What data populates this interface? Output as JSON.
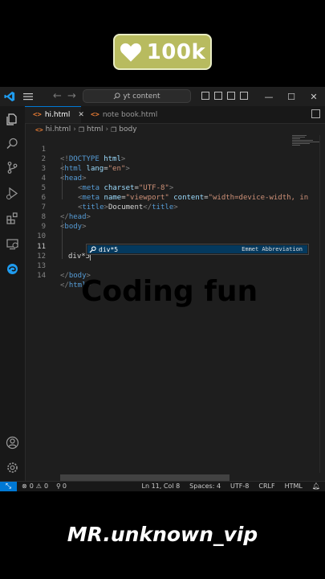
{
  "badge": {
    "count": "100k",
    "accent_color": "#b8bb5f"
  },
  "titlebar": {
    "search_text": "yt content"
  },
  "tabs": [
    {
      "label": "hi.html",
      "active": true
    },
    {
      "label": "note book.html",
      "active": false
    }
  ],
  "breadcrumb": [
    "hi.html",
    "html",
    "body"
  ],
  "editor": {
    "lines": [
      {
        "n": "1"
      },
      {
        "n": "2"
      },
      {
        "n": "3"
      },
      {
        "n": "4"
      },
      {
        "n": "5"
      },
      {
        "n": "6"
      },
      {
        "n": "7"
      },
      {
        "n": "8"
      },
      {
        "n": "9"
      },
      {
        "n": "10"
      },
      {
        "n": "11"
      },
      {
        "n": "12"
      },
      {
        "n": "13"
      },
      {
        "n": "14"
      }
    ],
    "code": {
      "l1": [
        "<!",
        "DOCTYPE",
        " html",
        ">"
      ],
      "l2": [
        "<",
        "html",
        " lang",
        "=",
        "\"en\"",
        ">"
      ],
      "l3": [
        "<",
        "head",
        ">"
      ],
      "l4": [
        "<",
        "meta",
        " charset",
        "=",
        "\"UTF-8\"",
        ">"
      ],
      "l5": [
        "<",
        "meta",
        " name",
        "=",
        "\"viewport\"",
        " content",
        "=",
        "\"width=device-width, in"
      ],
      "l6": [
        "<",
        "title",
        ">",
        "Document",
        "</",
        "title",
        ">"
      ],
      "l7": [
        "</",
        "head",
        ">"
      ],
      "l8": [
        "<",
        "body",
        ">"
      ],
      "l11": "div*5",
      "l13": [
        "</",
        "body",
        ">"
      ],
      "l14": [
        "</",
        "html",
        ">"
      ]
    }
  },
  "suggestion": {
    "label": "div*5",
    "detail": "Emmet Abbreviation"
  },
  "overlay_title": "Coding fun",
  "statusbar": {
    "errors": "0",
    "warnings": "0",
    "ports": "0",
    "position": "Ln 11, Col 8",
    "spaces": "Spaces: 4",
    "encoding": "UTF-8",
    "eol": "CRLF",
    "language": "HTML"
  },
  "handle": "MR.unknown_vip"
}
